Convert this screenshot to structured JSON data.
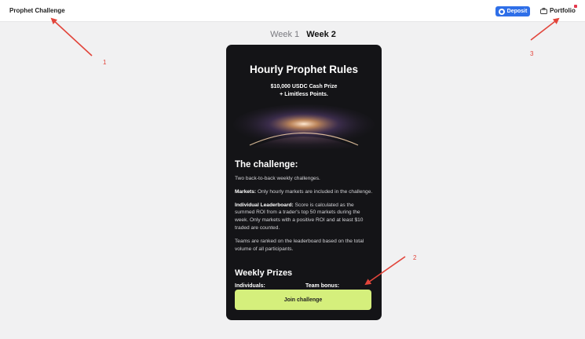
{
  "header": {
    "app_title": "Prophet Challenge",
    "deposit_label": "Deposit",
    "portfolio_label": "Portfolio"
  },
  "week_tabs": [
    {
      "label": "Week 1",
      "active": false
    },
    {
      "label": "Week 2",
      "active": true
    }
  ],
  "rules_card": {
    "title": "Hourly Prophet Rules",
    "prize_line_1": "$10,000 USDC Cash Prize",
    "prize_line_2": "+ Limitless Points.",
    "challenge_heading": "The challenge:",
    "intro": "Two back-to-back weekly challenges.",
    "markets_label": "Markets:",
    "markets_text": " Only hourly markets are included in the challenge.",
    "leaderboard_label": "Individual Leaderboard:",
    "leaderboard_text": " Score is calculated as the summed ROI from a trader's top 50 markets during the week. Only markets with a positive ROI and at least $10 traded are counted.",
    "teams_text": "Teams are ranked on the leaderboard based on the total volume of all participants.",
    "prizes_heading": "Weekly Prizes",
    "individuals_label": "Individuals:",
    "team_bonus_label": "Team bonus:",
    "join_label": "Join challenge"
  },
  "annotations": {
    "labels": [
      "1",
      "2",
      "3"
    ],
    "color": "#e2453b"
  },
  "colors": {
    "deposit_button": "#2f6fe8",
    "card_background": "#141417",
    "join_button": "#d5ef7c",
    "notification_dot": "#e5384d"
  }
}
